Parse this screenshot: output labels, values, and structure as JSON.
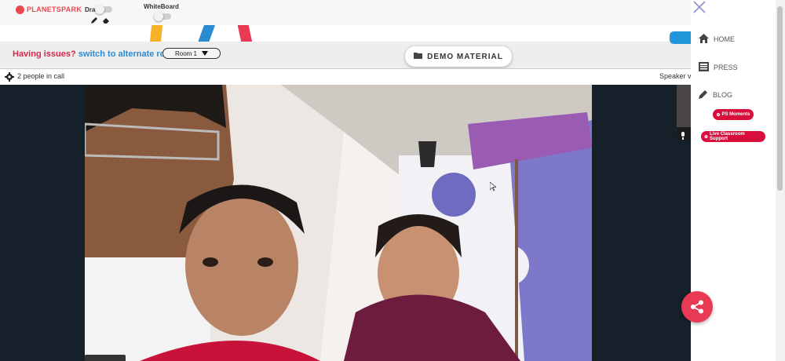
{
  "logo": {
    "text": "PLANETSPARK"
  },
  "toolbar": {
    "draw_label": "Draw",
    "whiteboard_label": "WhiteBoard",
    "icons": [
      "pencil-icon",
      "eraser-icon"
    ]
  },
  "banner": {
    "issues_text": "Having issues?",
    "switch_text": "switch to alternate room",
    "room_selected": "Room 1",
    "demo_button": "DEMO MATERIAL"
  },
  "call": {
    "people_text": "2 people in call",
    "speaker_view_text": "Speaker view"
  },
  "sidebar": {
    "nav": [
      {
        "label": "HOME",
        "icon": "home-icon"
      },
      {
        "label": "PRESS",
        "icon": "newspaper-icon"
      },
      {
        "label": "BLOG",
        "icon": "pencil-icon"
      }
    ],
    "pills": [
      {
        "label": "PS Moments"
      },
      {
        "label": "Live Classroom Support"
      }
    ]
  },
  "colors": {
    "brand_red": "#d80e3c",
    "link_blue": "#2b8bd1",
    "share_pink": "#e83a55",
    "video_bg": "#15202a"
  }
}
